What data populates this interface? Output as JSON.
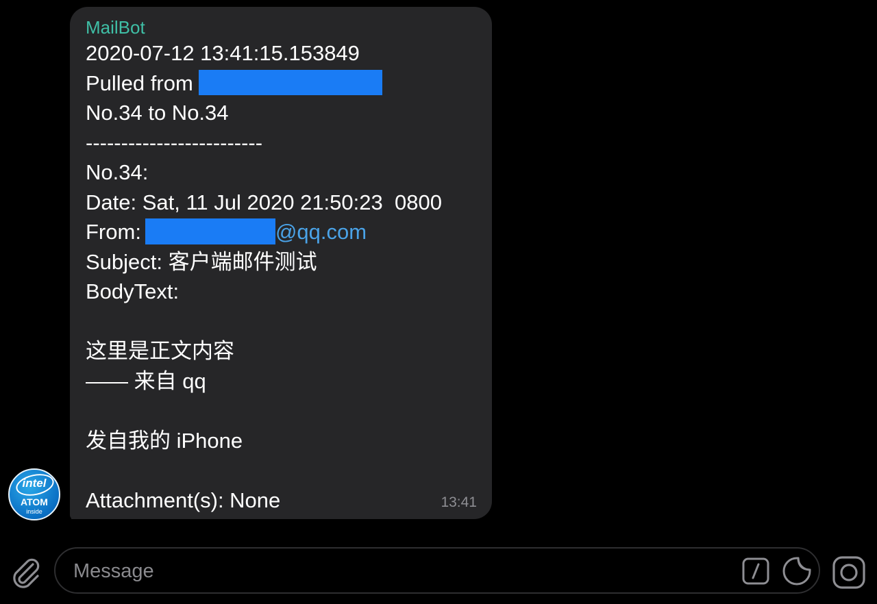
{
  "message": {
    "sender": "MailBot",
    "timestamp_line": "2020-07-12 13:41:15.153849",
    "pulled_from_label": "Pulled from",
    "range_line": "No.34 to No.34",
    "separator": "-------------------------",
    "item_number": "No.34:",
    "date_line": "Date: Sat, 11 Jul 2020 21:50:23  0800",
    "from_label": "From:",
    "from_domain": "@qq.com",
    "subject_line": "Subject: 客户端邮件测试",
    "bodytext_label": "BodyText:",
    "body_line_1": "这里是正文内容",
    "body_line_2": "—— 来自 qq",
    "body_line_3": "发自我的 iPhone",
    "attachments_line": "Attachment(s): None",
    "time": "13:41"
  },
  "avatar": {
    "brand": "intel",
    "product": "ATOM",
    "tagline": "inside"
  },
  "composer": {
    "placeholder": "Message"
  },
  "colors": {
    "background": "#000000",
    "bubble": "#262628",
    "sender": "#3fbfa6",
    "link": "#4aa3e8",
    "redaction": "#1a7cf5",
    "timestamp": "#8e8e93"
  },
  "icons": {
    "attach": "paperclip-icon",
    "commands": "slash-command-icon",
    "sticker": "sticker-icon",
    "camera": "camera-icon"
  }
}
